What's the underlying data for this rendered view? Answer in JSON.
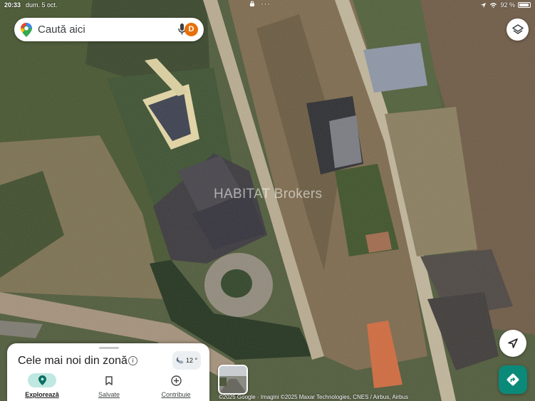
{
  "status_bar": {
    "time": "20:33",
    "date": "dum. 5 oct.",
    "battery": "92 %",
    "battery_level": 0.92
  },
  "search": {
    "placeholder": "Caută aici",
    "avatar_letter": "D",
    "icons": [
      "maps-pin-icon",
      "mic-icon"
    ]
  },
  "map": {
    "watermark": "HABITAT Brokers",
    "attribution": "©2025 Google · Imagini ©2025 Maxar Technologies, CNES / Airbus, Airbus"
  },
  "controls": {
    "layers_icon": "layers-icon",
    "navigation_icon": "navigation-arrow-icon",
    "directions_icon": "directions-icon"
  },
  "bottom_sheet": {
    "title": "Cele mai noi din zonă",
    "info_icon": "i",
    "weather": {
      "temp": "12 °",
      "icon": "moon-cloud-icon"
    },
    "tabs": [
      {
        "label": "Explorează",
        "icon": "explore-pin-icon",
        "active": true
      },
      {
        "label": "Salvate",
        "icon": "bookmark-icon",
        "active": false
      },
      {
        "label": "Contribuie",
        "icon": "add-circle-icon",
        "active": false
      }
    ]
  },
  "colors": {
    "accent": "#0b8a7a",
    "active_tab_bg": "#bfe8e2",
    "avatar": "#e8710a"
  }
}
